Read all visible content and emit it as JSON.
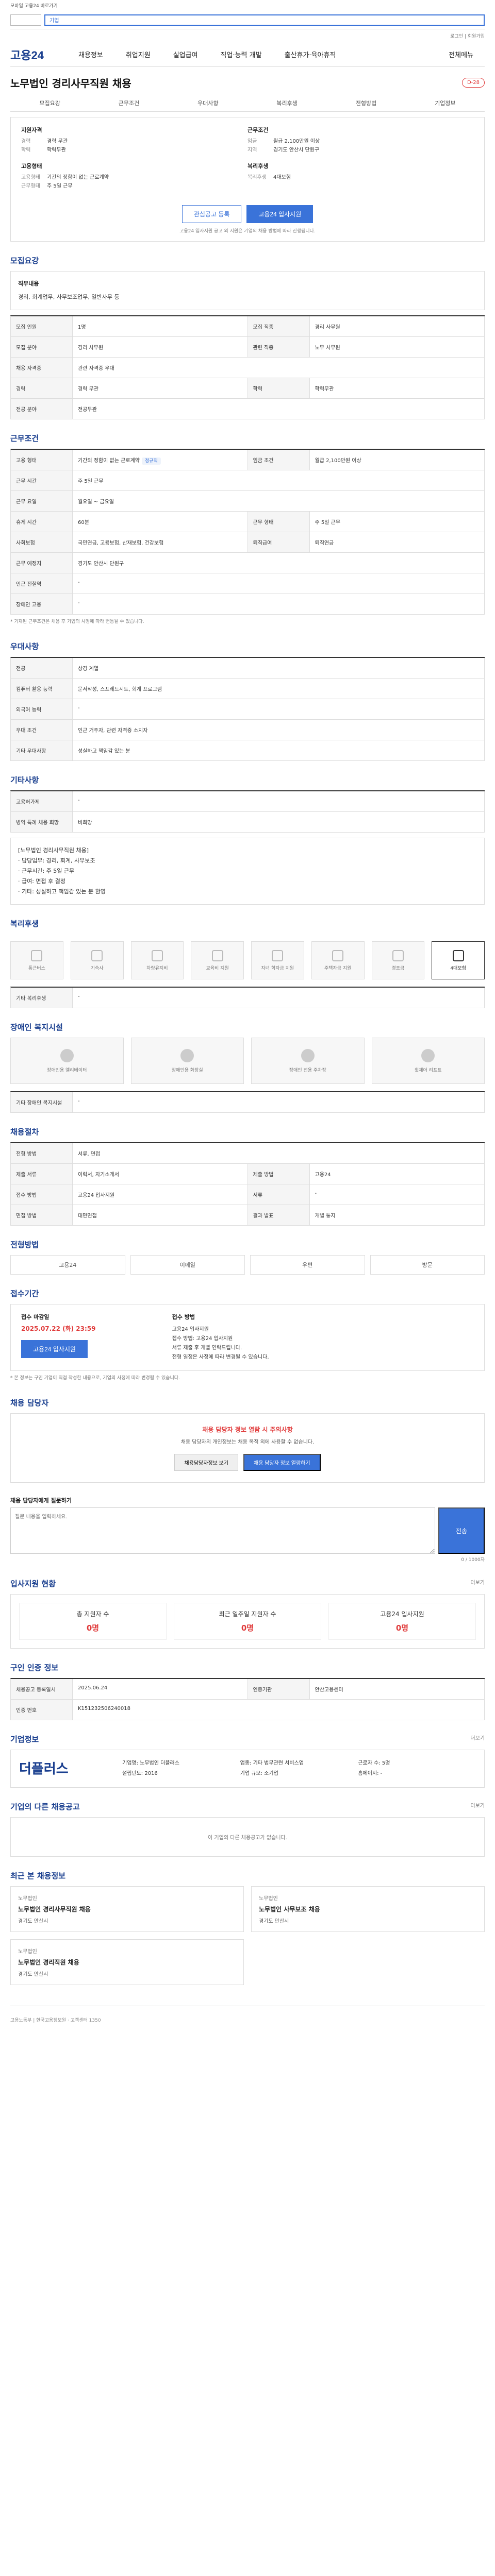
{
  "topnote": "모바일 고용24 바로가기",
  "search": {
    "text": "기업"
  },
  "util": "로그인 | 회원가입",
  "nav": {
    "logo": "고용24",
    "items": [
      "채용정보",
      "취업지원",
      "실업급여",
      "직업·능력 개발",
      "출산휴가·육아휴직"
    ],
    "more": "전체메뉴"
  },
  "job": {
    "title": "노무법인 경리사무직원 채용",
    "badge": "D-28"
  },
  "tabs": [
    "모집요강",
    "근무조건",
    "우대사항",
    "복리후생",
    "전형방법",
    "기업정보"
  ],
  "summary": {
    "left_title": "지원자격",
    "left": [
      {
        "k": "경력",
        "v": "경력 무관"
      },
      {
        "k": "학력",
        "v": "학력무관"
      }
    ],
    "left2_title": "고용형태",
    "left2": [
      {
        "k": "고용형태",
        "v": "기간의 정함이 없는 근로계약"
      },
      {
        "k": "근무형태",
        "v": "주 5일 근무"
      }
    ],
    "right_title": "근무조건",
    "right": [
      {
        "k": "임금",
        "v": "월급 2,100만원 이상"
      },
      {
        "k": "지역",
        "v": "경기도 안산시 단원구"
      }
    ],
    "right2_title": "복리후생",
    "right2": [
      {
        "k": "복리후생",
        "v": "4대보험"
      }
    ]
  },
  "buttons": {
    "scrap": "관심공고 등록",
    "apply": "고용24 입사지원"
  },
  "micro": "고용24 입사지원 공고 외 지원은 기업의 채용 방법에 따라 진행됩니다.",
  "recruit": {
    "header": "모집요강",
    "job_title": "직무내용",
    "job_desc": "경리, 회계업무, 사무보조업무, 일반사무 등",
    "rows": [
      {
        "h": "모집 인원",
        "v": "1명",
        "h2": "모집 직종",
        "v2": "경리 사무원"
      },
      {
        "h": "모집 분야",
        "v": "경리 사무원",
        "h2": "관련 직종",
        "v2": "노무 사무원"
      },
      {
        "h": "채용 자격증",
        "v": "관련 자격증 우대",
        "h2": "",
        "v2": ""
      },
      {
        "h": "경력",
        "v": "경력 무관",
        "h2": "학력",
        "v2": "학력무관"
      },
      {
        "h": "전공 분야",
        "v": "전공무관",
        "h2": "",
        "v2": ""
      }
    ]
  },
  "cond": {
    "header": "근무조건",
    "rows": [
      {
        "h": "고용 형태",
        "v": "기간의 정함이 없는 근로계약",
        "tag": "정규직",
        "h2": "임금 조건",
        "v2": "월급 2,100만원 이상"
      },
      {
        "h": "근무 시간",
        "v": "주 5일 근무",
        "h2": "",
        "v2": ""
      },
      {
        "h": "근무 요일",
        "v": "월요일 ~ 금요일",
        "h2": "",
        "v2": ""
      },
      {
        "h": "휴게 시간",
        "v": "60분",
        "h2": "근무 형태",
        "v2": "주 5일 근무"
      },
      {
        "h": "사회보험",
        "v": "국민연금, 고용보험, 산재보험, 건강보험",
        "h2": "퇴직급여",
        "v2": "퇴직연금"
      },
      {
        "h": "근무 예정지",
        "v": "경기도 안산시 단원구",
        "h2": "",
        "v2": ""
      },
      {
        "h": "인근 전철역",
        "v": "-",
        "h2": "",
        "v2": ""
      },
      {
        "h": "장애인 고용",
        "v": "-",
        "h2": "",
        "v2": ""
      }
    ],
    "note": "* 기재된 근무조건은 채용 후 기업의 사정에 따라 변동될 수 있습니다."
  },
  "pref": {
    "header": "우대사항",
    "rows": [
      {
        "h": "전공",
        "v": "상경 계열"
      },
      {
        "h": "컴퓨터 활용 능력",
        "v": "문서작성, 스프레드시트, 회계 프로그램"
      },
      {
        "h": "외국어 능력",
        "v": "-"
      },
      {
        "h": "우대 조건",
        "v": "인근 거주자, 관련 자격증 소지자"
      },
      {
        "h": "기타 우대사항",
        "v": "성실하고 책임감 있는 분"
      }
    ]
  },
  "etc": {
    "header": "기타사항",
    "rows": [
      {
        "h": "고용허가제",
        "v": "-"
      },
      {
        "h": "병역 특례 채용 희망",
        "v": "비희망"
      }
    ],
    "desc_lines": [
      "[노무법인 경리사무직원 채용]",
      "· 담당업무: 경리, 회계, 사무보조",
      "· 근무시간: 주 5일 근무",
      "· 급여: 면접 후 결정",
      "· 기타: 성실하고 책임감 있는 분 환영"
    ]
  },
  "welfare": {
    "header": "복리후생",
    "items": [
      "통근버스",
      "기숙사",
      "차량유지비",
      "교육비 지원",
      "자녀 학자금 지원",
      "주택자금 지원",
      "경조금",
      "4대보험"
    ],
    "active": 7,
    "extra_h": "기타 복리후생",
    "extra_v": "-"
  },
  "disab": {
    "header": "장애인 복지시설",
    "items": [
      "장애인용 엘리베이터",
      "장애인용 화장실",
      "장애인 전용 주차장",
      "휠체어 리프트"
    ],
    "extra_h": "기타 장애인 복지시설",
    "extra_v": "-"
  },
  "proc": {
    "header": "채용절차",
    "rows": [
      {
        "h": "전형 방법",
        "v": "서류, 면접"
      },
      {
        "h": "제출 서류",
        "v": "이력서, 자기소개서",
        "h2": "제출 방법",
        "v2": "고용24"
      },
      {
        "h": "접수 방법",
        "v": "고용24 입사지원",
        "h2": "서류",
        "v2": "-"
      },
      {
        "h": "면접 방법",
        "v": "대면면접",
        "h2": "결과 발표",
        "v2": "개별 통지"
      }
    ]
  },
  "applym": {
    "header": "전형방법",
    "items": [
      "고용24",
      "이메일",
      "우편",
      "방문"
    ]
  },
  "period": {
    "header": "접수기간",
    "label": "접수 마감일",
    "date": "2025.07.22 (화) 23:59",
    "sub_label": "접수 방법",
    "sub": "고용24 입사지원",
    "btn": "고용24 입사지원",
    "desc_lines": [
      "접수 방법: 고용24 입사지원",
      "서류 제출 후 개별 연락드립니다.",
      "전형 일정은 사정에 따라 변경될 수 있습니다."
    ],
    "notice": "* 본 정보는 구인 기업이 직접 작성한 내용으로, 기업의 사정에 따라 변경될 수 있습니다."
  },
  "mgr": {
    "header": "채용 담당자",
    "warn": "채용 담당자 정보 열람 시 주의사항",
    "desc": "채용 담당자의 개인정보는 채용 목적 외에 사용할 수 없습니다.",
    "b1": "채용담당자정보 보기",
    "b2": "채용 담당자 정보 열람하기"
  },
  "qa": {
    "header": "채용 담당자에게 질문하기",
    "placeholder": "질문 내용을 입력하세요.",
    "btn": "전송",
    "count": "0 / 1000자"
  },
  "stats": {
    "header": "입사지원 현황",
    "items": [
      {
        "l": "총 지원자 수",
        "v": "0명"
      },
      {
        "l": "최근 일주일 지원자 수",
        "v": "0명"
      },
      {
        "l": "고용24 입사지원",
        "v": "0명"
      }
    ],
    "more": "더보기"
  },
  "info": {
    "header": "구인 인증 정보",
    "rows": [
      {
        "h": "채용공고 등록일시",
        "v": "2025.06.24",
        "h2": "인증기관",
        "v2": "안산고용센터"
      },
      {
        "h": "인증 번호",
        "v": "K151232506240018",
        "h2": "",
        "v2": ""
      }
    ]
  },
  "company": {
    "header": "기업정보",
    "logo": "더플러스",
    "lines": [
      "기업명: 노무법인 더플러스",
      "업종: 기타 법무관련 서비스업",
      "근로자 수: 5명",
      "설립년도: 2016",
      "기업 규모: 소기업",
      "홈페이지: -"
    ],
    "more": "더보기"
  },
  "similar": {
    "header": "기업의 다른 채용공고",
    "empty": "이 기업의 다른 채용공고가 없습니다.",
    "more": "더보기"
  },
  "recent": {
    "header": "최근 본 채용정보",
    "cards": [
      {
        "n": "노무법인",
        "t": "노무법인 경리사무직원 채용",
        "l": "경기도 안산시"
      },
      {
        "n": "노무법인",
        "t": "노무법인 사무보조 채용",
        "l": "경기도 안산시"
      },
      {
        "n": "노무법인",
        "t": "노무법인 경리직원 채용",
        "l": "경기도 안산시"
      }
    ]
  },
  "footer": "고용노동부 | 한국고용정보원 · 고객센터 1350"
}
